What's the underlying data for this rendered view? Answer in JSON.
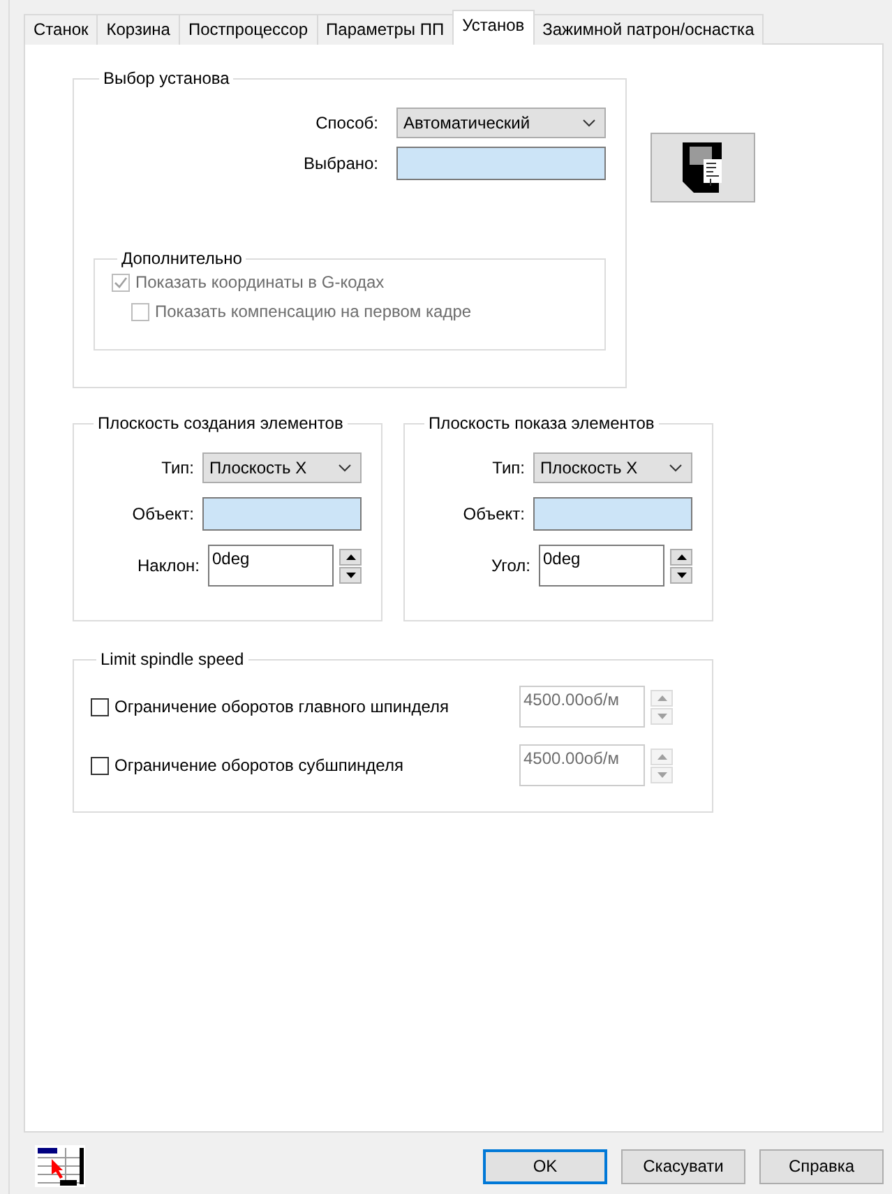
{
  "tabs": [
    {
      "label": "Станок",
      "selected": false
    },
    {
      "label": "Корзина",
      "selected": false
    },
    {
      "label": "Постпроцессор",
      "selected": false
    },
    {
      "label": "Параметры ПП",
      "selected": false
    },
    {
      "label": "Установ",
      "selected": true
    },
    {
      "label": "Зажимной патрон/оснастка",
      "selected": false
    }
  ],
  "setup_selection": {
    "title": "Выбор установа",
    "method": {
      "label": "Способ:",
      "value": "Автоматический"
    },
    "selected": {
      "label": "Выбрано:"
    },
    "additional": {
      "title": "Дополнительно",
      "options": [
        {
          "label": "Показать координаты в G-кодах",
          "checked": true,
          "disabled": true,
          "children": [
            {
              "label": "Показать компенсацию на первом кадре",
              "checked": false,
              "disabled": true
            }
          ]
        }
      ]
    }
  },
  "planes": [
    {
      "title": "Плоскость создания элементов",
      "type": {
        "label": "Тип:",
        "value": "Плоскость X"
      },
      "object": {
        "label": "Объект:"
      },
      "angle": {
        "label": "Наклон:",
        "value": "0deg"
      }
    },
    {
      "title": "Плоскость показа элементов",
      "type": {
        "label": "Тип:",
        "value": "Плоскость X"
      },
      "object": {
        "label": "Объект:"
      },
      "angle": {
        "label": "Угол:",
        "value": "0deg"
      }
    }
  ],
  "limit_spindle_speed": {
    "title": "Limit spindle speed",
    "rows": [
      {
        "label": "Ограничение оборотов главного шпинделя",
        "checked": false,
        "value": "4500.00об/м",
        "disabled": true
      },
      {
        "label": "Ограничение оборотов субшпинделя",
        "checked": false,
        "value": "4500.00об/м",
        "disabled": true
      }
    ]
  },
  "buttons": [
    {
      "label": "OK",
      "default": true
    },
    {
      "label": "Скасувати",
      "default": false
    },
    {
      "label": "Справка",
      "default": false
    }
  ]
}
